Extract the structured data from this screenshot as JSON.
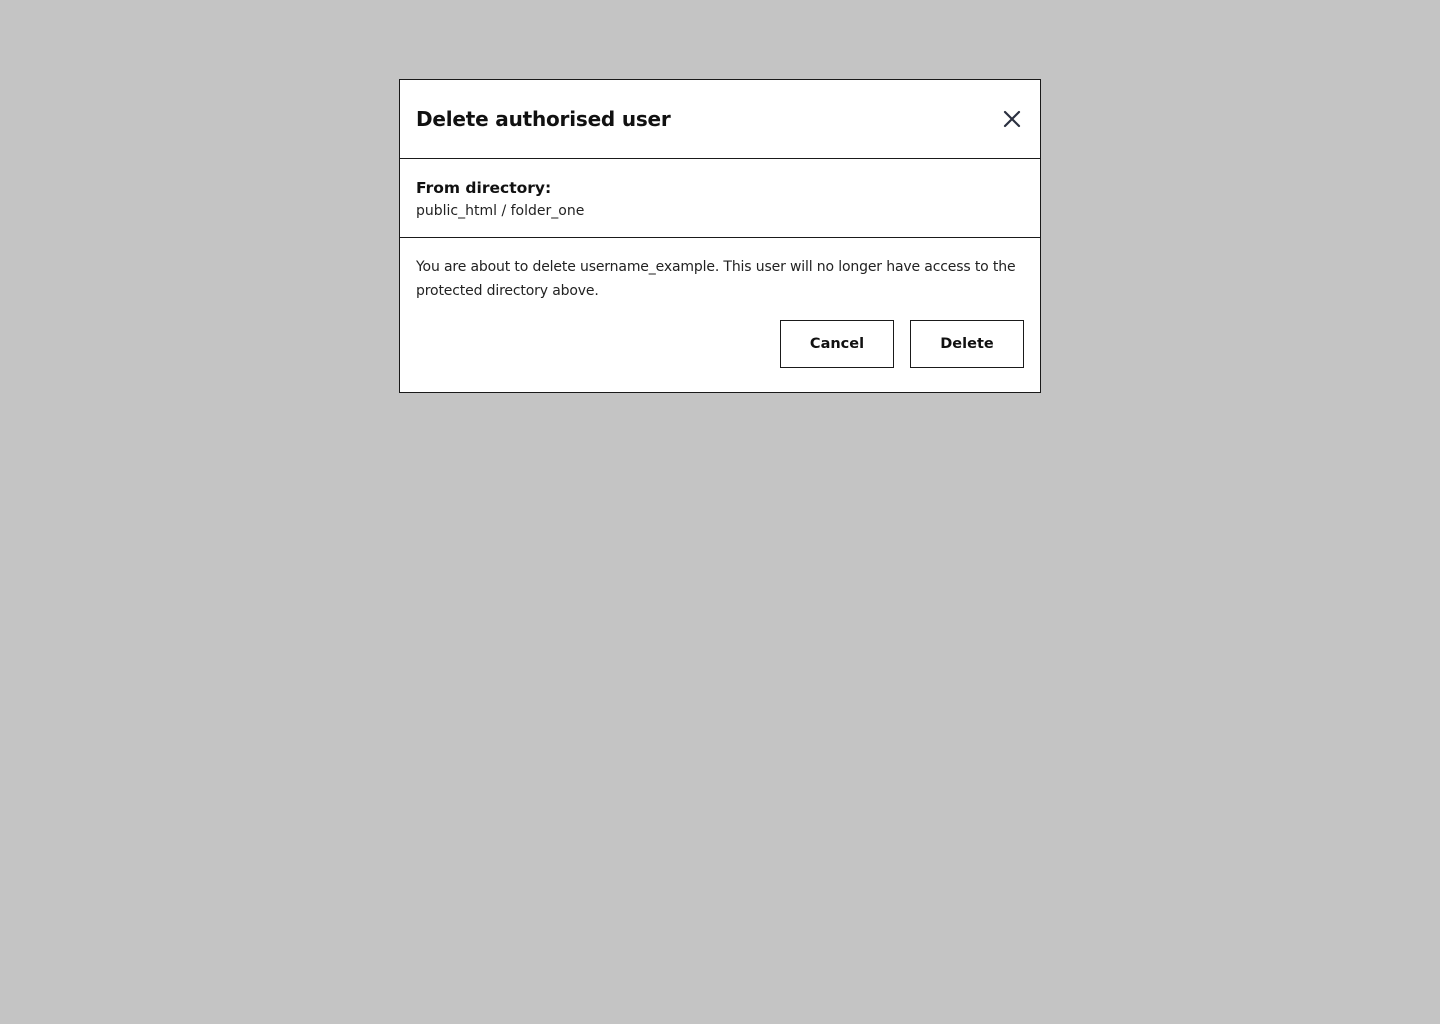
{
  "modal": {
    "title": "Delete authorised user",
    "close_icon": "close-icon",
    "directory": {
      "label": "From directory:",
      "path": "public_html / folder_one"
    },
    "message": "You are about to delete username_example. This user will no longer have access to the protected directory above.",
    "actions": {
      "cancel_label": "Cancel",
      "delete_label": "Delete"
    }
  },
  "colors": {
    "backdrop": "#c4c4c4",
    "surface": "#ffffff",
    "border": "#1a1a1a",
    "text": "#111111",
    "icon": "#2b3040"
  }
}
